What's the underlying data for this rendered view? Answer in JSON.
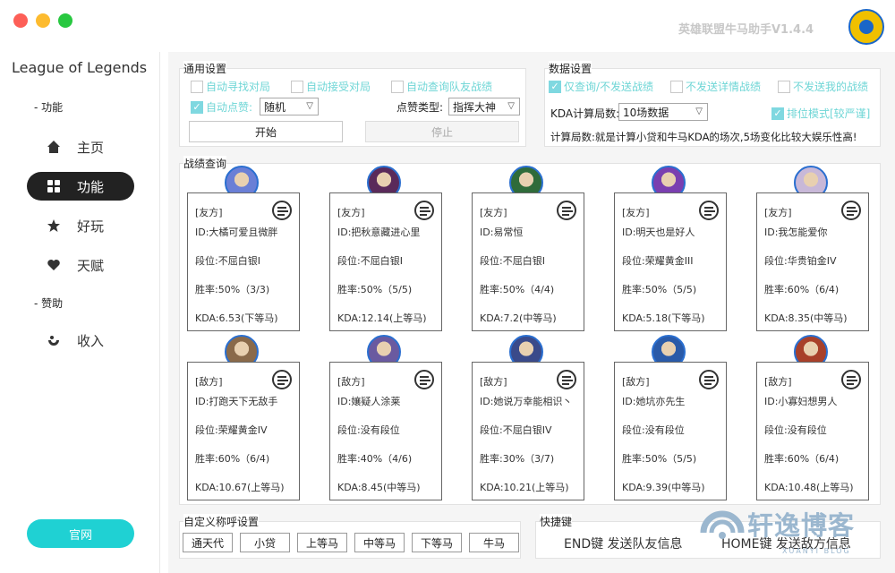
{
  "window": {
    "title": "英雄联盟牛马助手V1.4.4"
  },
  "sidebar": {
    "brand": "League of Legends",
    "section_feature": "功能",
    "section_sponsor": "赞助",
    "items": [
      {
        "label": "主页",
        "icon": "home-icon"
      },
      {
        "label": "功能",
        "icon": "grid-icon"
      },
      {
        "label": "好玩",
        "icon": "star-icon"
      },
      {
        "label": "天赋",
        "icon": "heart-icon"
      },
      {
        "label": "收入",
        "icon": "income-icon"
      }
    ],
    "official_button": "官网"
  },
  "general": {
    "title": "通用设置",
    "auto_find": "自动寻找对局",
    "auto_accept": "自动接受对局",
    "auto_query": "自动查询队友战绩",
    "auto_like": "自动点赞:",
    "like_mode": "随机",
    "like_type_label": "点赞类型:",
    "like_type": "指挥大神",
    "start": "开始",
    "stop": "停止"
  },
  "data_settings": {
    "title": "数据设置",
    "only_query": "仅查询/不发送战绩",
    "no_detail": "不发送详情战绩",
    "no_mine": "不发送我的战绩",
    "kda_label": "KDA计算局数:",
    "kda_value": "10场数据",
    "rank_mode": "排位模式[较严谨]",
    "note": "计算局数:就是计算小贷和牛马KDA的场次,5场变化比较大娱乐性高!"
  },
  "record": {
    "title": "战绩查询",
    "allies": [
      {
        "side": "[友方]",
        "id": "ID:大橘可爱且微胖",
        "rank": "段位:不屈白银I",
        "winrate": "胜率:50%（3/3)",
        "kda": "KDA:6.53(下等马)"
      },
      {
        "side": "[友方]",
        "id": "ID:把秋意藏进心里",
        "rank": "段位:不屈白银I",
        "winrate": "胜率:50%（5/5)",
        "kda": "KDA:12.14(上等马)"
      },
      {
        "side": "[友方]",
        "id": "ID:易常恒",
        "rank": "段位:不屈白银I",
        "winrate": "胜率:50%（4/4)",
        "kda": "KDA:7.2(中等马)"
      },
      {
        "side": "[友方]",
        "id": "ID:明天也是好人",
        "rank": "段位:荣耀黄金III",
        "winrate": "胜率:50%（5/5)",
        "kda": "KDA:5.18(下等马)"
      },
      {
        "side": "[友方]",
        "id": "ID:我怎能爱你",
        "rank": "段位:华贵铂金IV",
        "winrate": "胜率:60%（6/4)",
        "kda": "KDA:8.35(中等马)"
      }
    ],
    "enemies": [
      {
        "side": "[敌方]",
        "id": "ID:打跑天下无敌手",
        "rank": "段位:荣耀黄金IV",
        "winrate": "胜率:60%（6/4)",
        "kda": "KDA:10.67(上等马)"
      },
      {
        "side": "[敌方]",
        "id": "ID:孃疑人涂莱",
        "rank": "段位:没有段位",
        "winrate": "胜率:40%（4/6)",
        "kda": "KDA:8.45(中等马)"
      },
      {
        "side": "[敌方]",
        "id": "ID:她说万幸能相识丶",
        "rank": "段位:不屈白银IV",
        "winrate": "胜率:30%（3/7)",
        "kda": "KDA:10.21(上等马)"
      },
      {
        "side": "[敌方]",
        "id": "ID:她坑亦先生",
        "rank": "段位:没有段位",
        "winrate": "胜率:50%（5/5)",
        "kda": "KDA:9.39(中等马)"
      },
      {
        "side": "[敌方]",
        "id": "ID:小寡妇想男人",
        "rank": "段位:没有段位",
        "winrate": "胜率:60%（6/4)",
        "kda": "KDA:10.48(上等马)"
      }
    ]
  },
  "custom": {
    "title": "自定义称呼设置",
    "tags": [
      "通天代",
      "小贷",
      "上等马",
      "中等马",
      "下等马",
      "牛马"
    ]
  },
  "hotkeys": {
    "title": "快捷键",
    "end": "END键 发送队友信息",
    "home": "HOME键 发送敌方信息"
  },
  "watermark": {
    "text": "轩逸博客",
    "sub": "XUANYI BLOG"
  },
  "colors": {
    "accent": "#1fd1d3",
    "checkbox": "#7fd8e0",
    "dark": "#222222"
  }
}
